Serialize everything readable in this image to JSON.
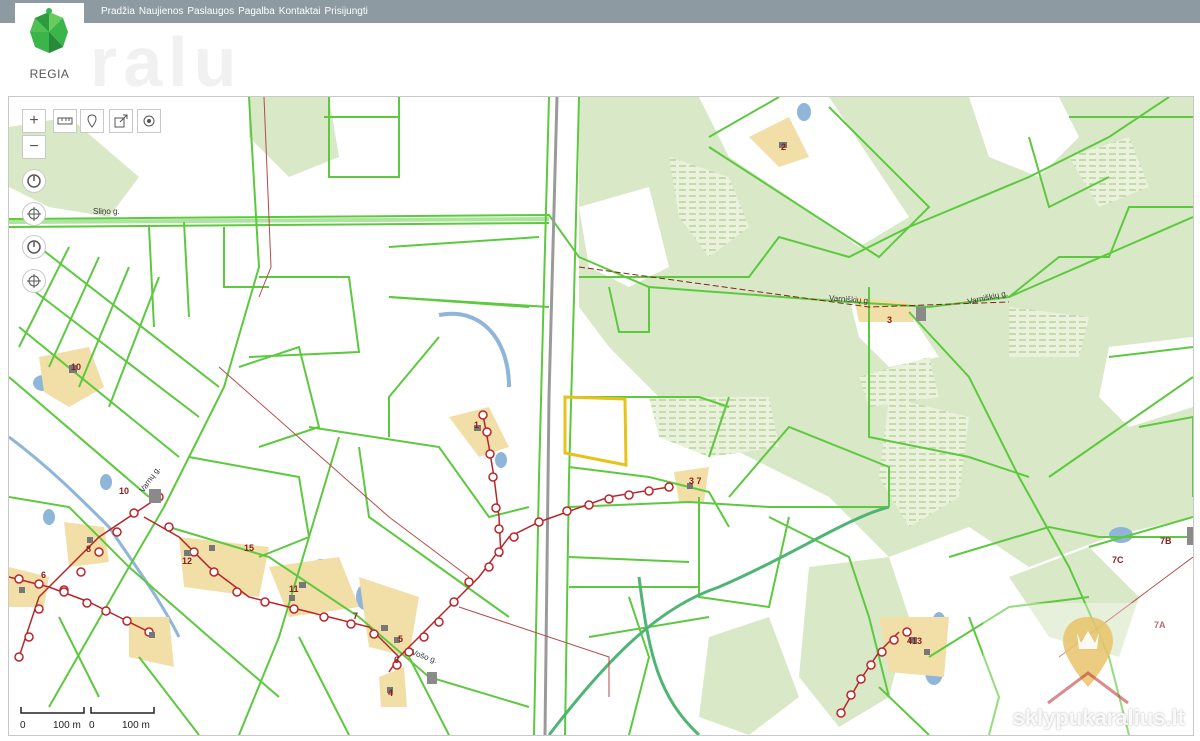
{
  "app": {
    "logo_text": "REGIA",
    "background_watermark": "ralu"
  },
  "nav": {
    "items": [
      "Pradžia",
      "Naujienos",
      "Paslaugos",
      "Pagalba",
      "Kontaktai",
      "Prisijungti"
    ]
  },
  "controls": {
    "zoom_in": "+",
    "zoom_out": "−"
  },
  "map": {
    "road_labels": [
      "Sliņo g.",
      "Varniškių g.",
      "Varniškių g.",
      "Varnų g.",
      "Vošo g."
    ],
    "parcel_labels": [
      "2",
      "3",
      "10",
      "1",
      "10",
      "8",
      "12",
      "15",
      "6",
      "11",
      "7",
      "5",
      "6",
      "4",
      "3 7",
      "413",
      "7B",
      "7C",
      "7A"
    ],
    "scale": {
      "left_zero": "0",
      "left_value": "100 m",
      "right_zero": "0",
      "right_value": "100 m"
    }
  },
  "watermark": {
    "text": "sklypukaralius.lt"
  },
  "colors": {
    "parcel": "#5cc93e",
    "forest": "#d9e9c7",
    "selected": "#e8c21a",
    "route": "#b8262b",
    "water": "#8fb5d8",
    "settlement": "#f1dfa7"
  }
}
